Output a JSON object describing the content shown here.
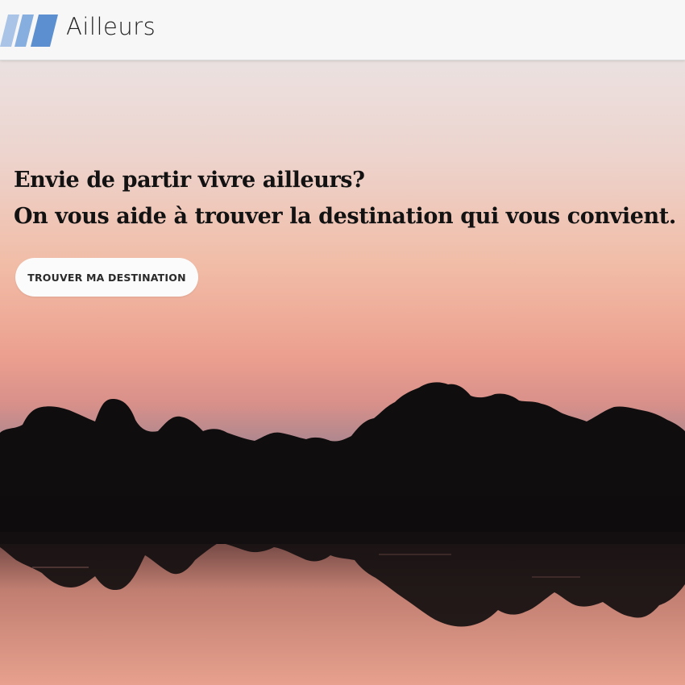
{
  "header": {
    "brand_name": "Ailleurs",
    "logo_icon": "stripes-logo-icon",
    "logo_color": "#5b8fcf"
  },
  "hero": {
    "title_line_1": "Envie de partir vivre ailleurs?",
    "title_line_2": "On vous aide à trouver la destination qui vous convient.",
    "cta_label": "TROUVER MA DESTINATION",
    "background_image": "sunset-lake-trees-photo",
    "sky_colors": [
      "#eadbdb",
      "#f0b9a3",
      "#e89a8e",
      "#8e7f90"
    ]
  }
}
